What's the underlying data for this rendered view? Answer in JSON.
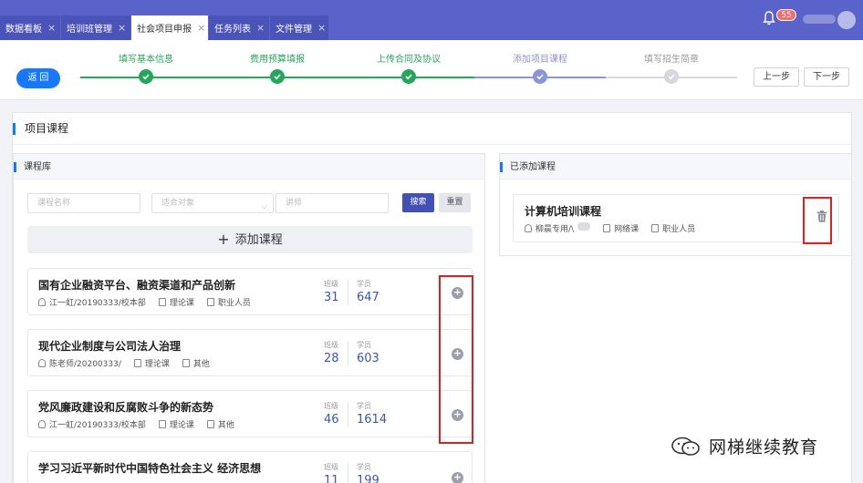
{
  "tabs": [
    {
      "label": "数据看板",
      "active": false
    },
    {
      "label": "培训班管理",
      "active": false
    },
    {
      "label": "社会项目申报",
      "active": true
    },
    {
      "label": "任务列表",
      "active": false
    },
    {
      "label": "文件管理",
      "active": false
    }
  ],
  "notifications": {
    "count": "55"
  },
  "back_label": "返 回",
  "steps": [
    {
      "label": "填写基本信息",
      "status": "done"
    },
    {
      "label": "费用预算填报",
      "status": "done"
    },
    {
      "label": "上传合同及协议",
      "status": "done"
    },
    {
      "label": "添加项目课程",
      "status": "current"
    },
    {
      "label": "填写招生简章",
      "status": "todo"
    }
  ],
  "prev_label": "上一步",
  "next_label": "下一步",
  "section_title": "项目课程",
  "library": {
    "title": "课程库",
    "filters": {
      "course_name_placeholder": "课程名称",
      "audience_placeholder": "适合对象",
      "lecturer_placeholder": "讲师"
    },
    "search_label": "搜索",
    "reset_label": "重置",
    "add_course_label": "添加课程",
    "class_label": "班级",
    "student_label": "学员",
    "courses": [
      {
        "name": "国有企业融资平台、融资渠道和产品创新",
        "author": "江一虹/20190333/校本部",
        "type": "理论课",
        "audience": "职业人员",
        "classes": "31",
        "students": "647"
      },
      {
        "name": "现代企业制度与公司法人治理",
        "author": "陈老师/20200333/",
        "type": "理论课",
        "audience": "其他",
        "classes": "28",
        "students": "603"
      },
      {
        "name": "党风廉政建设和反腐败斗争的新态势",
        "author": "江一虹/20190333/校本部",
        "type": "理论课",
        "audience": "其他",
        "classes": "46",
        "students": "1614"
      },
      {
        "name": "学习习近平新时代中国特色社会主义 经济思想",
        "author": "",
        "type": "",
        "audience": "",
        "classes": "11",
        "students": "199"
      }
    ]
  },
  "added": {
    "title": "已添加课程",
    "courses": [
      {
        "name": "计算机培训课程",
        "author": "柳晨专用/\\",
        "type": "网络课",
        "audience": "职业人员"
      }
    ]
  },
  "watermark": "网梯继续教育",
  "colors": {
    "accent": "#1677ff",
    "done": "#26a65b",
    "current": "#8a94d6",
    "todo": "#c9ccd3",
    "highlight": "#e02020"
  }
}
